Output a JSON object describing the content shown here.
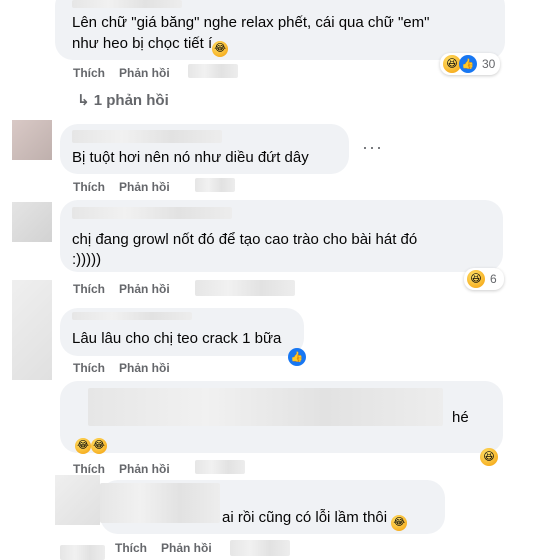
{
  "comments": [
    {
      "line1": "Lên chữ \"giá băng\" nghe relax phết, cái qua chữ \"em\"",
      "line2": "như heo bị chọc tiết í",
      "like_label": "Thích",
      "reply_label": "Phản hồi",
      "reaction_count": "30"
    },
    {
      "replies_link": "1 phản hồi"
    },
    {
      "text": "Bị tuột hơi nên nó như diều đứt dây",
      "like_label": "Thích",
      "reply_label": "Phản hồi"
    },
    {
      "line1": "chị đang growl nốt đó để tạo cao trào cho bài hát đó",
      "line2": ":)))))",
      "like_label": "Thích",
      "reply_label": "Phản hồi",
      "reaction_count": "6"
    },
    {
      "text": "Lâu lâu cho chị teo crack 1 bữa",
      "like_label": "Thích",
      "reply_label": "Phản hồi"
    },
    {
      "text_tail": "hé",
      "like_label": "Thích",
      "reply_label": "Phản hồi"
    },
    {
      "text_tail": "ai rồi cũng có lỗi lầm thôi",
      "like_label": "Thích",
      "reply_label": "Phản hồi"
    }
  ],
  "icons": {
    "haha": "haha-reaction-icon",
    "like": "like-reaction-icon",
    "reply_arrow": "reply-arrow-icon",
    "more": "more-options-icon"
  },
  "colors": {
    "bubble": "#f0f2f5",
    "text": "#050505",
    "meta": "#65676b",
    "like_blue": "#1877f2"
  }
}
